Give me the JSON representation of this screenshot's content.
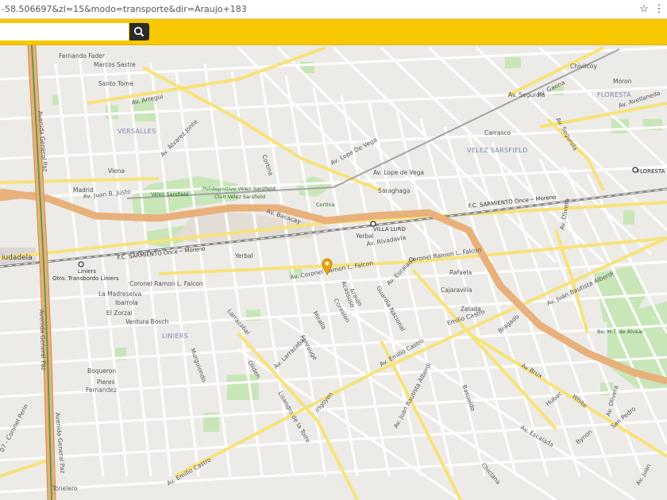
{
  "browser": {
    "url": "-58.506697&zl=15&modo=transporte&dir=Araujo+183",
    "star_icon": "star-icon",
    "menu_icon": "more-vert-icon"
  },
  "search": {
    "value": "",
    "button_icon": "search-icon"
  },
  "map": {
    "marker_icon": "location-pin-icon",
    "colors": {
      "land": "#ecebe7",
      "park": "#c8e6b8",
      "highway": "#e8b07a",
      "avenue": "#f8e27a",
      "street": "#ffffff"
    },
    "neighborhoods": {
      "versalles": "VERSALLES",
      "velez": "VELEZ SARSFIELD",
      "floresta": "FLORESTA",
      "liniers": "LINIERS",
      "ciudadela": "iudadela"
    },
    "rail": {
      "sarmiento_w": "F.C. SARMIENTO   Once ─ Moreno",
      "sarmiento_e": "F.C. SARMIENTO   Once ─ Moreno",
      "liniers": "Liniers",
      "transbordo": "Otro. Transbordo Liniers",
      "villa_luro": "VILLA LURO",
      "floresta_st": "FLORESTA"
    },
    "places": {
      "poli1": "Polideportivo Vélez Sarsfield",
      "poli2": "Club Vélez Sarsfield",
      "velez": "Vélez Sarsfield",
      "mt_alvear": "Bo. M.T. de Alvear",
      "cortina": "Cortina"
    },
    "streets": {
      "arregui": "Av. Arregui",
      "alvarez_jonte": "Av. Álvarez Jonte",
      "juan_b_justo": "Av. Juan B. Justo",
      "bacacay": "Av. Bacacay",
      "rivadavia": "Av. Rivadavia",
      "falcon": "Av. Coronel Ramon L. Falcon",
      "falcon2": "Coronel Ramon L. Falcon",
      "falcon3": "Coronel Ramon L. Falcon",
      "lope_vega": "Av. Lope De Vega",
      "lope_vega2": "Av. Lope de Vega",
      "gaona": "Av. Gaona",
      "segurola": "Av. Segurola",
      "segurola2": "Av. Segurola",
      "avellaneda": "Av. Avellaneda",
      "olivera": "Av. Olivera",
      "olivera2": "Av. Olivera",
      "juan_b_alberdi": "Av. Juan Bautista Alberdi",
      "juan_b_alberdi2": "Av. Juan Bautista Alberdi",
      "escalada": "Av. Escalada",
      "escalada2": "Av. Escalada",
      "larrazabal": "Av. Larrazabal",
      "larrazabal2": "Larrazabal",
      "emilio_castro": "Av. Emilio Castro",
      "emilio_castro2": "Av. Emilio Castro",
      "emilio_castro3": "Emilio Castro",
      "brux": "Av Brux",
      "gral_paz": "Avenida General Paz",
      "gral_paz2": "Avenida General Paz",
      "gral_paz3": "Avenida General Paz",
      "coronel_perin": "07 - Coronel Perin",
      "carrasco": "Carrasco",
      "chivilcoy": "Chivilcoy",
      "moron": "Moron",
      "yerbal": "Yerbal",
      "yerbal2": "Yerbal",
      "saraghaga": "Saraghaga",
      "madariaga": "La Madreselva",
      "ibarrola": "Ibarrola",
      "el_zorzal": "El Zorzal",
      "ventura_bosch": "Ventura Bosch",
      "rafaela": "Rafaela",
      "zelada": "Zelada",
      "cajaravilla": "Cajaravilla",
      "acassuso": "Acassuso",
      "fernandez": "Fernandez",
      "boqueron": "Boqueron",
      "pieres": "Pieres",
      "tonelero": "Tonelero",
      "santo_tome": "Santo Tome",
      "marcos_sastre": "Marcos Sastre",
      "fernando_fader": "Fernando Fader",
      "madrid": "Madrid",
      "viena": "Viena",
      "cortina_st": "Cortina",
      "chiclana": "Chiclana",
      "basualdo": "Basualdo",
      "murguiondo": "Murguiondo",
      "bragado": "Bragado",
      "guardia_nacional": "Guardia Nacional",
      "irigoyen": "Irigoyen",
      "miralla": "Miralla",
      "lisandro": "Lisandro de la Torre",
      "corvalan": "Corvalan",
      "araujo": "Araujo",
      "fonrouge": "Fonrouge",
      "oliden": "Oliden",
      "hubac": "Hubac",
      "bynon": "Bynon",
      "white": "White",
      "san_pedro": "San Pedro",
      "av_juan": "Av. Juan"
    }
  }
}
